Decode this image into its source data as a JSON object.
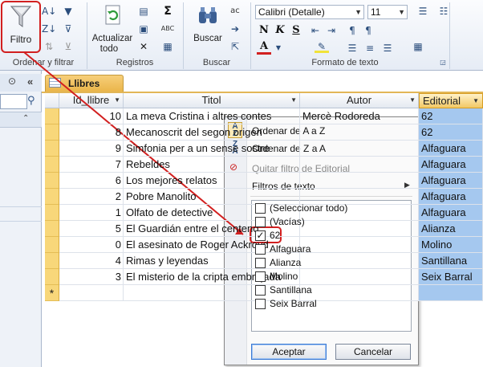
{
  "ribbon": {
    "filter_label": "Filtro",
    "groups": {
      "sort_filter": "Ordenar y filtrar",
      "records": "Registros",
      "find": "Buscar",
      "text_format": "Formato de texto"
    },
    "refresh_label_line1": "Actualizar",
    "refresh_label_line2": "todo",
    "find_label": "Buscar",
    "font_name": "Calibri (Detalle)",
    "font_size": "11",
    "sum_symbol": "Σ",
    "replace_icon_text": "ac",
    "spell_icon_text": "ABC"
  },
  "tab": {
    "label": "Llibres"
  },
  "table": {
    "columns": [
      "Id_llibre",
      "Titol",
      "Autor",
      "Editorial"
    ],
    "rows": [
      {
        "id": "10",
        "titol": "La meva Cristina i altres contes",
        "autor": "Mercè Rodoreda",
        "editorial": "62"
      },
      {
        "id": "8",
        "titol": "Mecanoscrit del segon origen",
        "autor": "",
        "editorial": "62"
      },
      {
        "id": "9",
        "titol": "Simfonia per a un sense sostre",
        "autor": "",
        "editorial": "Alfaguara"
      },
      {
        "id": "7",
        "titol": "Rebeldes",
        "autor": "",
        "editorial": "Alfaguara"
      },
      {
        "id": "6",
        "titol": "Los mejores relatos",
        "autor": "",
        "editorial": "Alfaguara"
      },
      {
        "id": "2",
        "titol": "Pobre Manolito",
        "autor": "",
        "editorial": "Alfaguara"
      },
      {
        "id": "1",
        "titol": "Olfato de detective",
        "autor": "",
        "editorial": "Alfaguara"
      },
      {
        "id": "5",
        "titol": "El Guardián entre el centeno",
        "autor": "",
        "editorial": "Alianza"
      },
      {
        "id": "0",
        "titol": "El asesinato de Roger Ackroyd",
        "autor": "",
        "editorial": "Molino"
      },
      {
        "id": "4",
        "titol": "Rimas y leyendas",
        "autor": "",
        "editorial": "Santillana"
      },
      {
        "id": "3",
        "titol": "El misterio de la cripta embrujada",
        "autor": "",
        "editorial": "Seix Barral"
      }
    ],
    "new_row_marker": "*"
  },
  "filter_menu": {
    "sort_asc": "Ordenar de A a Z",
    "sort_desc": "Ordenar de Z a A",
    "clear_filter": "Quitar filtro de Editorial",
    "text_filters": "Filtros de texto",
    "options": [
      {
        "label": "(Seleccionar todo)",
        "checked": false
      },
      {
        "label": "(Vacías)",
        "checked": false
      },
      {
        "label": "62",
        "checked": true
      },
      {
        "label": "Alfaguara",
        "checked": false
      },
      {
        "label": "Alianza",
        "checked": false
      },
      {
        "label": "Molino",
        "checked": false
      },
      {
        "label": "Santillana",
        "checked": false
      },
      {
        "label": "Seix Barral",
        "checked": false
      }
    ],
    "accept": "Aceptar",
    "cancel": "Cancelar"
  },
  "annotation_color": "#d22020",
  "accent_blue": "#a5c8ef"
}
